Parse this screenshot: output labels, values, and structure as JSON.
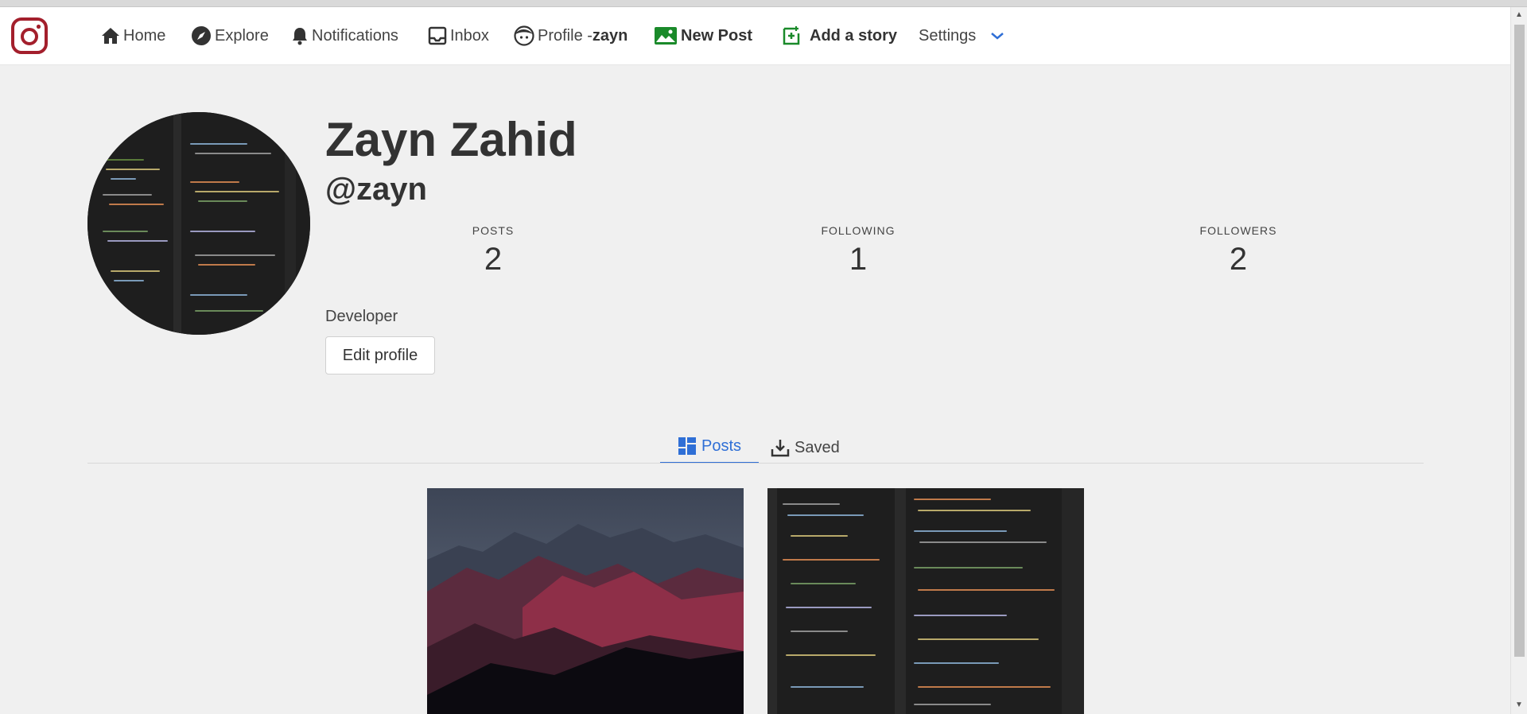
{
  "nav": {
    "home": "Home",
    "explore": "Explore",
    "notifications": "Notifications",
    "inbox": "Inbox",
    "profile_prefix": "Profile -",
    "profile_user": "zayn",
    "new_post": "New Post",
    "add_story": "Add a story",
    "settings": "Settings"
  },
  "profile": {
    "name": "Zayn Zahid",
    "handle": "@zayn",
    "bio": "Developer",
    "edit_label": "Edit profile",
    "stats": {
      "posts_label": "POSTS",
      "posts": "2",
      "following_label": "FOLLOWING",
      "following": "1",
      "followers_label": "FOLLOWERS",
      "followers": "2"
    }
  },
  "tabs": {
    "posts": "Posts",
    "saved": "Saved"
  },
  "colors": {
    "logo": "#a31f2c",
    "accent": "#2f6fd6",
    "new_post": "#1a8a2a"
  },
  "icons": [
    "instagram-icon",
    "home-icon",
    "compass-icon",
    "bell-icon",
    "inbox-icon",
    "face-icon",
    "image-icon",
    "add-story-icon",
    "chevron-down-icon",
    "grid-icon",
    "download-icon"
  ]
}
